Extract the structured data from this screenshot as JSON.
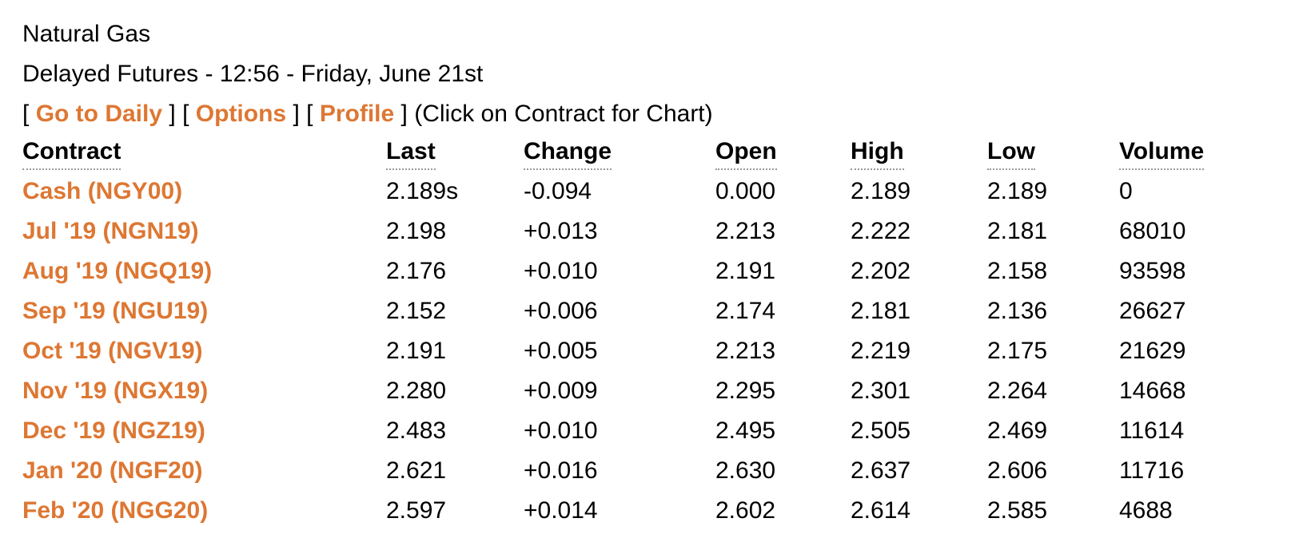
{
  "colors": {
    "accent": "#DD7733",
    "text": "#000000",
    "background": "#FFFFFF",
    "header_underline": "#9A9A9A"
  },
  "header": {
    "commodity": "Natural Gas",
    "subtitle": "Delayed Futures - 12:56 - Friday, June 21st",
    "nav": {
      "open_bracket": "[",
      "close_bracket": "]",
      "links": [
        {
          "label": "Go to Daily",
          "name": "go-to-daily-link"
        },
        {
          "label": "Options",
          "name": "options-link"
        },
        {
          "label": "Profile",
          "name": "profile-link"
        }
      ],
      "hint": "(Click on Contract for Chart)"
    }
  },
  "table": {
    "columns": [
      {
        "key": "contract",
        "label": "Contract"
      },
      {
        "key": "last",
        "label": "Last"
      },
      {
        "key": "change",
        "label": "Change"
      },
      {
        "key": "open",
        "label": "Open"
      },
      {
        "key": "high",
        "label": "High"
      },
      {
        "key": "low",
        "label": "Low"
      },
      {
        "key": "volume",
        "label": "Volume"
      }
    ],
    "rows": [
      {
        "contract": "Cash (NGY00)",
        "last": "2.189s",
        "change": "-0.094",
        "open": "0.000",
        "high": "2.189",
        "low": "2.189",
        "volume": "0"
      },
      {
        "contract": "Jul '19 (NGN19)",
        "last": "2.198",
        "change": "+0.013",
        "open": "2.213",
        "high": "2.222",
        "low": "2.181",
        "volume": "68010"
      },
      {
        "contract": "Aug '19 (NGQ19)",
        "last": "2.176",
        "change": "+0.010",
        "open": "2.191",
        "high": "2.202",
        "low": "2.158",
        "volume": "93598"
      },
      {
        "contract": "Sep '19 (NGU19)",
        "last": "2.152",
        "change": "+0.006",
        "open": "2.174",
        "high": "2.181",
        "low": "2.136",
        "volume": "26627"
      },
      {
        "contract": "Oct '19 (NGV19)",
        "last": "2.191",
        "change": "+0.005",
        "open": "2.213",
        "high": "2.219",
        "low": "2.175",
        "volume": "21629"
      },
      {
        "contract": "Nov '19 (NGX19)",
        "last": "2.280",
        "change": "+0.009",
        "open": "2.295",
        "high": "2.301",
        "low": "2.264",
        "volume": "14668"
      },
      {
        "contract": "Dec '19 (NGZ19)",
        "last": "2.483",
        "change": "+0.010",
        "open": "2.495",
        "high": "2.505",
        "low": "2.469",
        "volume": "11614"
      },
      {
        "contract": "Jan '20 (NGF20)",
        "last": "2.621",
        "change": "+0.016",
        "open": "2.630",
        "high": "2.637",
        "low": "2.606",
        "volume": "11716"
      },
      {
        "contract": "Feb '20 (NGG20)",
        "last": "2.597",
        "change": "+0.014",
        "open": "2.602",
        "high": "2.614",
        "low": "2.585",
        "volume": "4688"
      }
    ]
  }
}
